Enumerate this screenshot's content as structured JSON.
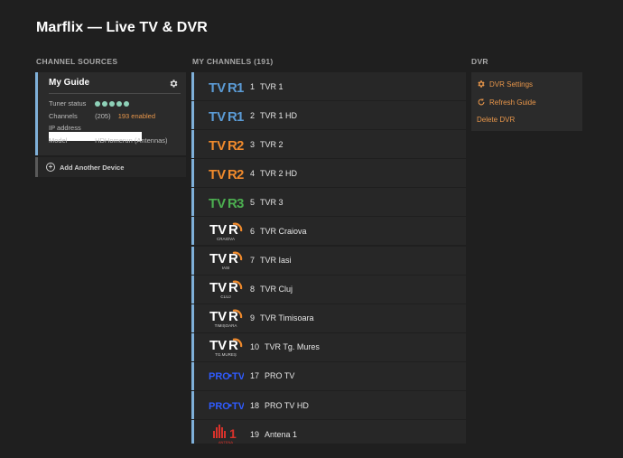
{
  "app": {
    "title": "Marflix — Live TV & DVR"
  },
  "sections": {
    "sources": "CHANNEL SOURCES",
    "channels": "MY CHANNELS (191)",
    "dvr": "DVR"
  },
  "device": {
    "name": "My Guide",
    "tuner_label": "Tuner status",
    "tuner_count": 5,
    "channels_label": "Channels",
    "channels_count": "(205)",
    "channels_enabled": "193 enabled",
    "ip_label": "IP address",
    "ip_value": "",
    "model_label": "Model",
    "model_value": "HDHomerun (Antennas)",
    "add_label": "Add Another Device"
  },
  "channels": [
    {
      "number": "1",
      "name": "TVR 1",
      "logo": "tvr1"
    },
    {
      "number": "2",
      "name": "TVR 1 HD",
      "logo": "tvr1"
    },
    {
      "number": "3",
      "name": "TVR 2",
      "logo": "tvr2"
    },
    {
      "number": "4",
      "name": "TVR 2 HD",
      "logo": "tvr2"
    },
    {
      "number": "5",
      "name": "TVR 3",
      "logo": "tvr3"
    },
    {
      "number": "6",
      "name": "TVR Craiova",
      "logo": "tvr-regional",
      "sub": "CRAIOVA"
    },
    {
      "number": "7",
      "name": "TVR Iasi",
      "logo": "tvr-regional",
      "sub": "IASI"
    },
    {
      "number": "8",
      "name": "TVR Cluj",
      "logo": "tvr-regional",
      "sub": "CLUJ"
    },
    {
      "number": "9",
      "name": "TVR Timisoara",
      "logo": "tvr-regional",
      "sub": "TIMIȘOARA"
    },
    {
      "number": "10",
      "name": "TVR Tg. Mures",
      "logo": "tvr-regional",
      "sub": "TG.MUREȘ"
    },
    {
      "number": "17",
      "name": "PRO TV",
      "logo": "protv"
    },
    {
      "number": "18",
      "name": "PRO TV HD",
      "logo": "protv"
    },
    {
      "number": "19",
      "name": "Antena 1",
      "logo": "antena1"
    }
  ],
  "dvr": {
    "settings_label": "DVR Settings",
    "refresh_label": "Refresh Guide",
    "delete_label": "Delete DVR"
  },
  "colors": {
    "accent": "#e8964a",
    "row_bar": "#7fb0d9",
    "tuner_ok": "#8ed1b8",
    "tvr1": "#5b9bd5",
    "tvr2": "#f08a2c",
    "tvr3": "#4caf50",
    "protv": "#2f5bff",
    "antena": "#d8322b"
  }
}
